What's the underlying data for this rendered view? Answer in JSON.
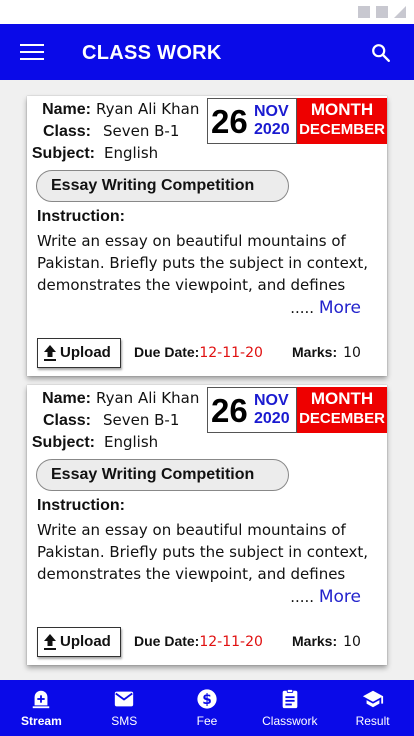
{
  "app_bar": {
    "title": "CLASS WORK"
  },
  "cards": [
    {
      "name_label": "Name:",
      "name": "Ryan Ali Khan",
      "class_label": "Class:",
      "class": "Seven B-1",
      "subject_label": "Subject:",
      "subject": "English",
      "day": "26",
      "month_short": "NOV",
      "year": "2020",
      "month_label": "MONTH",
      "month_name": "DECEMBER",
      "title": "Essay Writing Competition",
      "instruction_label": "Instruction:",
      "instruction_text": "Write an essay on beautiful mountains of Pakistan. Briefly puts the subject in context, demonstrates the viewpoint, and defines",
      "more_dots": ".....",
      "more_label": "More",
      "upload_label": "Upload",
      "due_label": "Due Date:",
      "due_value": "12-11-20",
      "marks_label": "Marks:",
      "marks_value": "10"
    },
    {
      "name_label": "Name:",
      "name": "Ryan Ali Khan",
      "class_label": "Class:",
      "class": "Seven B-1",
      "subject_label": "Subject:",
      "subject": "English",
      "day": "26",
      "month_short": "NOV",
      "year": "2020",
      "month_label": "MONTH",
      "month_name": "DECEMBER",
      "title": "Essay Writing Competition",
      "instruction_label": "Instruction:",
      "instruction_text": "Write an essay on beautiful mountains of Pakistan. Briefly puts the subject in context, demonstrates the viewpoint, and defines",
      "more_dots": ".....",
      "more_label": "More",
      "upload_label": "Upload",
      "due_label": "Due Date:",
      "due_value": "12-11-20",
      "marks_label": "Marks:",
      "marks_value": "10"
    }
  ],
  "bottom_nav": [
    {
      "label": "Stream",
      "icon": "stream-icon",
      "active": true
    },
    {
      "label": "SMS",
      "icon": "mail-icon",
      "active": false
    },
    {
      "label": "Fee",
      "icon": "dollar-icon",
      "active": false
    },
    {
      "label": "Classwork",
      "icon": "assignment-icon",
      "active": false
    },
    {
      "label": "Result",
      "icon": "school-icon",
      "active": false
    }
  ],
  "colors": {
    "primary": "#0a0ae8",
    "month_badge": "#ee0000",
    "date_text": "#1a1ad0",
    "due_date": "#e01010",
    "more_link": "#2222cc"
  }
}
